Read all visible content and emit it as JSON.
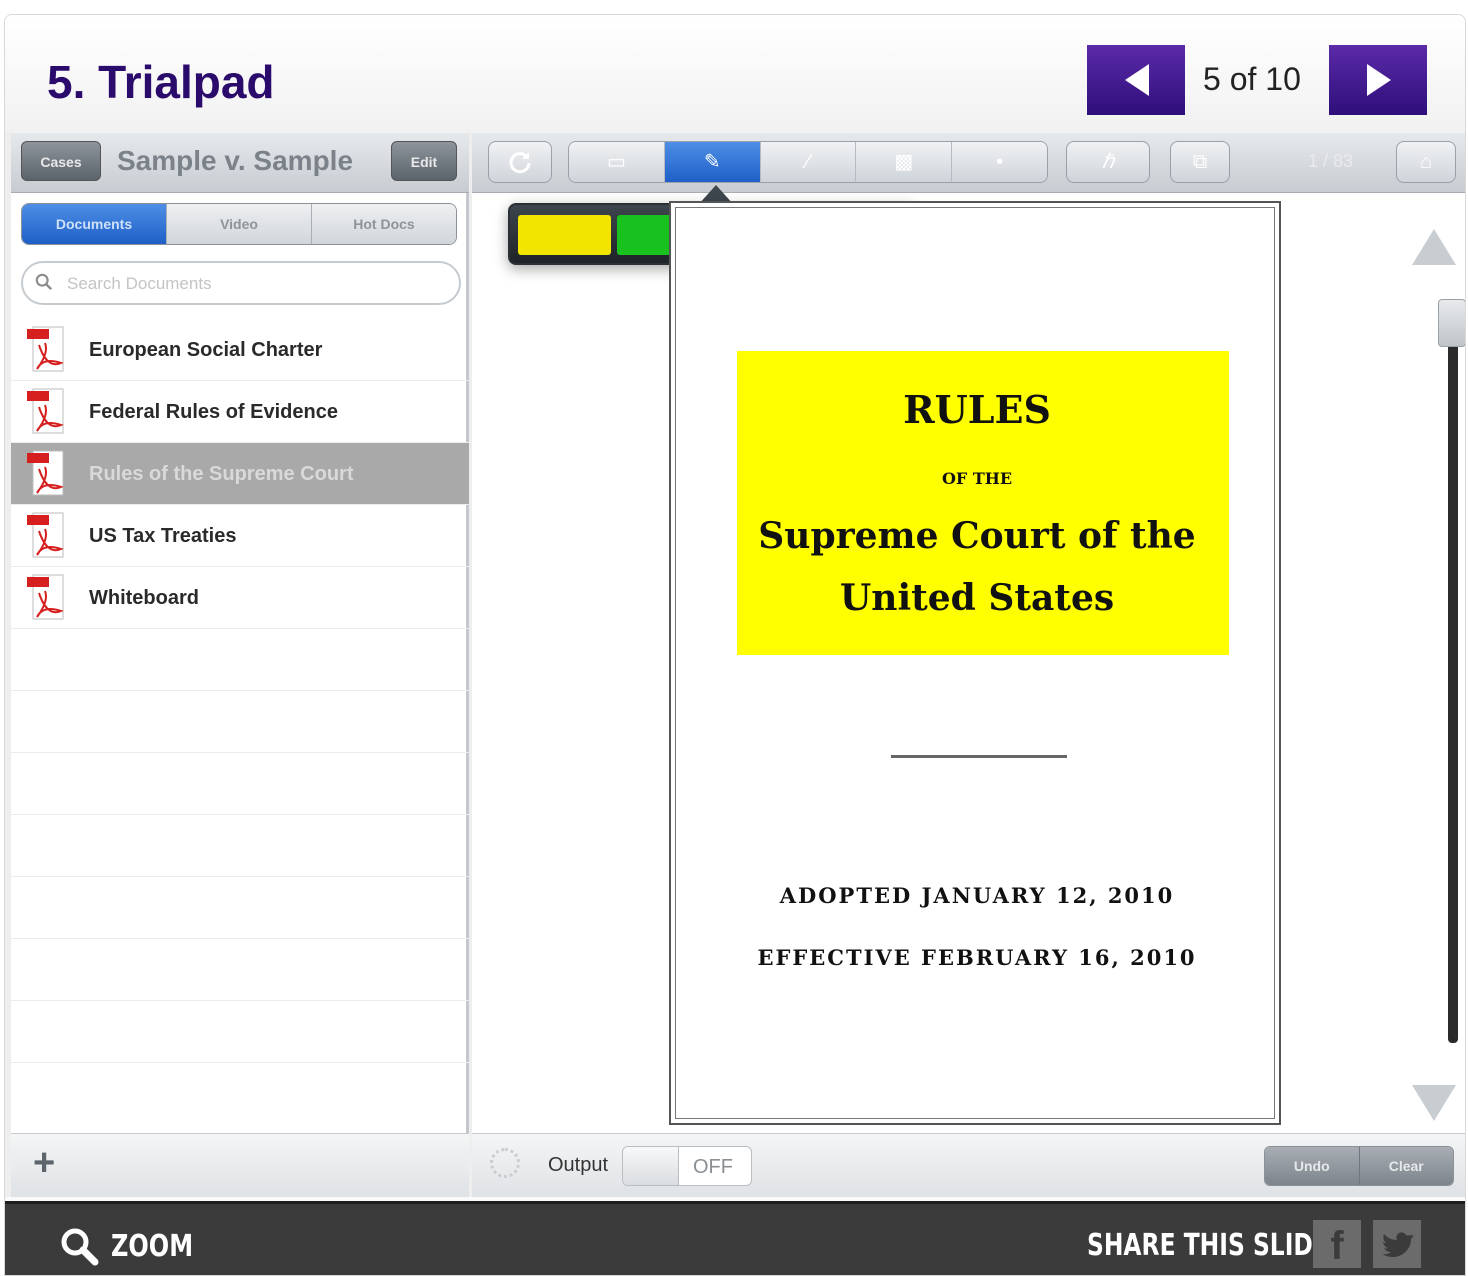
{
  "header": {
    "title": "5. Trialpad",
    "counter": "5 of 10"
  },
  "left": {
    "cases_label": "Cases",
    "case_title": "Sample v. Sample",
    "edit_label": "Edit",
    "tabs": [
      "Documents",
      "Video",
      "Hot Docs"
    ],
    "search_placeholder": "Search Documents",
    "documents": [
      {
        "label": "European Social Charter",
        "selected": false
      },
      {
        "label": "Federal Rules of Evidence",
        "selected": false
      },
      {
        "label": "Rules of the Supreme Court",
        "selected": true
      },
      {
        "label": "US Tax Treaties",
        "selected": false
      },
      {
        "label": "Whiteboard",
        "selected": false
      }
    ]
  },
  "toolbar": {
    "page_count": "1 / 83"
  },
  "highlight_colors": [
    "#f2e600",
    "#19c11e",
    "#2ee0d6",
    "#e07aec"
  ],
  "document": {
    "line1": "RULES",
    "line2": "OF THE",
    "line3": "Supreme Court of the",
    "line4": "United States",
    "adopted": "ADOPTED JANUARY 12, 2010",
    "effective": "EFFECTIVE FEBRUARY 16, 2010",
    "highlight_color": "#ffff00"
  },
  "footer": {
    "output_label": "Output",
    "toggle_state": "OFF",
    "undo_label": "Undo",
    "clear_label": "Clear"
  },
  "bottom": {
    "zoom_label": "ZOOM",
    "share_label": "SHARE THIS SLIDE"
  },
  "colors": {
    "nav_purple": "#3b1486",
    "title_color": "#2a0a6b",
    "selected_tab_blue": "#2d6fd6"
  }
}
